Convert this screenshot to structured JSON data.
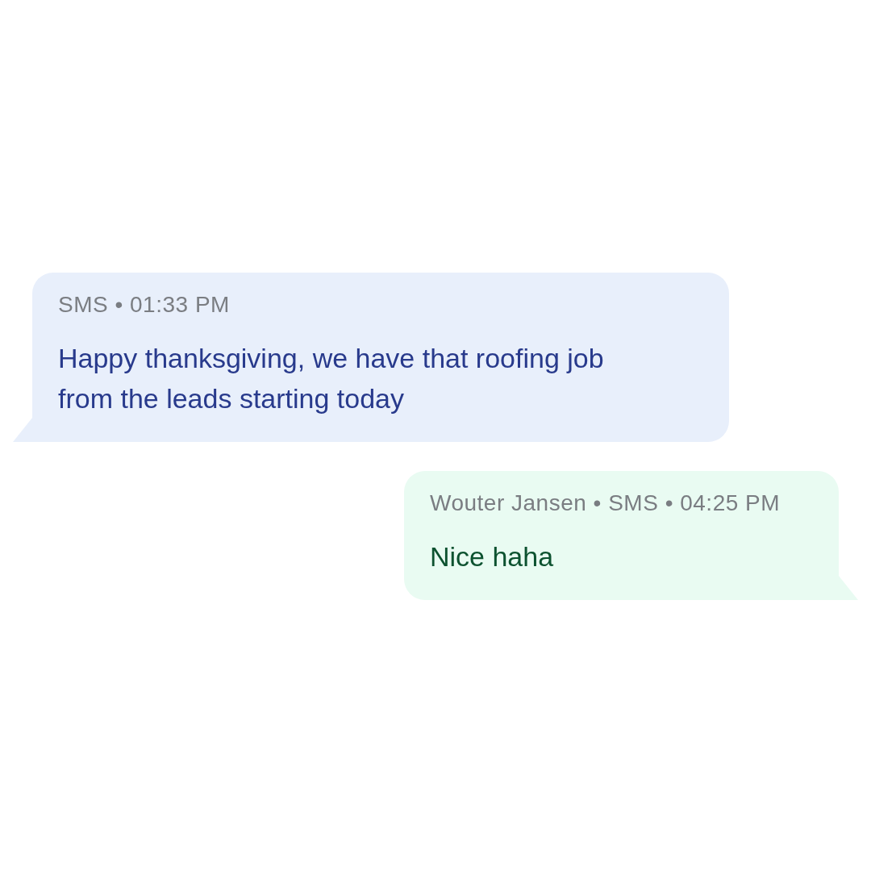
{
  "messages": [
    {
      "kind": "incoming",
      "meta": "SMS • 01:33 PM",
      "text": "Happy thanksgiving, we have that roofing job from the leads starting today"
    },
    {
      "kind": "outgoing",
      "meta": "Wouter Jansen • SMS • 04:25 PM",
      "text": "Nice haha"
    }
  ]
}
